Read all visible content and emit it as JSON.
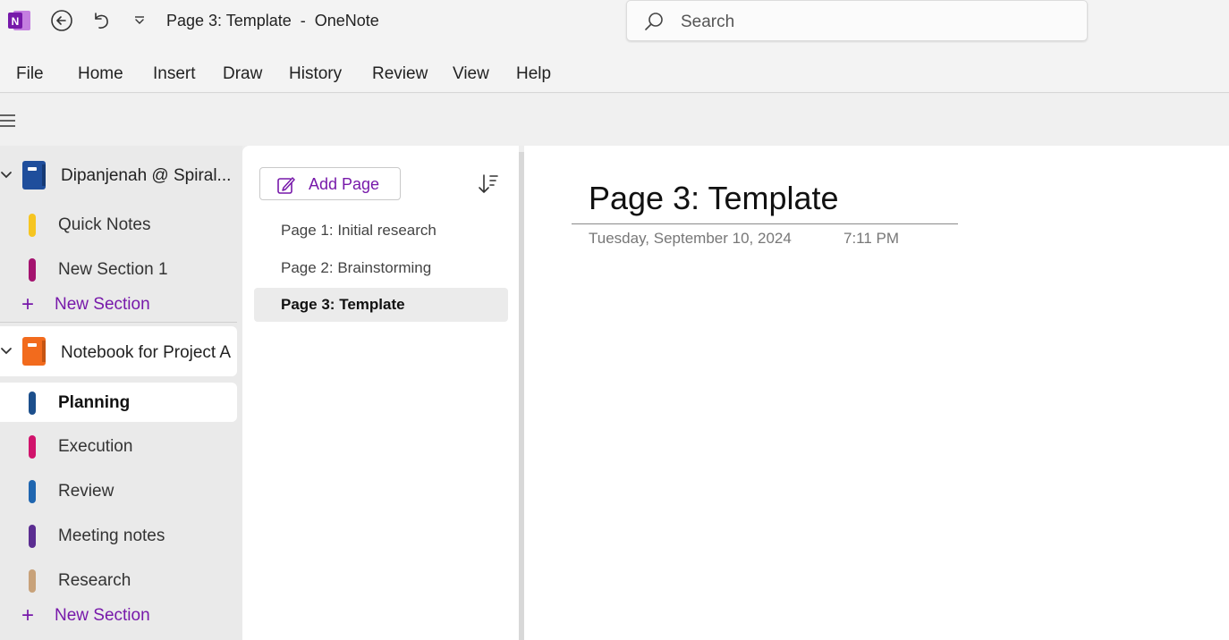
{
  "titlebar": {
    "window_title": "Page 3: Template  -  OneNote",
    "search_placeholder": "Search",
    "logo_letter": "N"
  },
  "menu": [
    "File",
    "Home",
    "Insert",
    "Draw",
    "History",
    "Review",
    "View",
    "Help"
  ],
  "notebooks": [
    {
      "title": "Dipanjenah @ Spiral...",
      "color": "#1f4e9c",
      "sections": [
        {
          "label": "Quick Notes",
          "color": "#f6c521"
        },
        {
          "label": "New Section 1",
          "color": "#a4136f"
        }
      ],
      "new_section_label": "New Section"
    },
    {
      "title": "Notebook for Project A",
      "color": "#f26b1d",
      "sections": [
        {
          "label": "Planning",
          "color": "#1c4f8c"
        },
        {
          "label": "Execution",
          "color": "#d1146c"
        },
        {
          "label": "Review",
          "color": "#1f66b0"
        },
        {
          "label": "Meeting notes",
          "color": "#5b2d91"
        },
        {
          "label": "Research",
          "color": "#c8a27a"
        }
      ],
      "new_section_label": "New Section"
    }
  ],
  "pages_pane": {
    "add_page_label": "Add Page",
    "pages": [
      "Page 1: Initial research",
      "Page 2: Brainstorming",
      "Page 3: Template"
    ]
  },
  "page": {
    "title": "Page 3: Template",
    "date": "Tuesday, September 10, 2024",
    "time": "7:11 PM"
  },
  "colors": {
    "accent": "#7719aa",
    "logo_bg": "#7719aa"
  }
}
